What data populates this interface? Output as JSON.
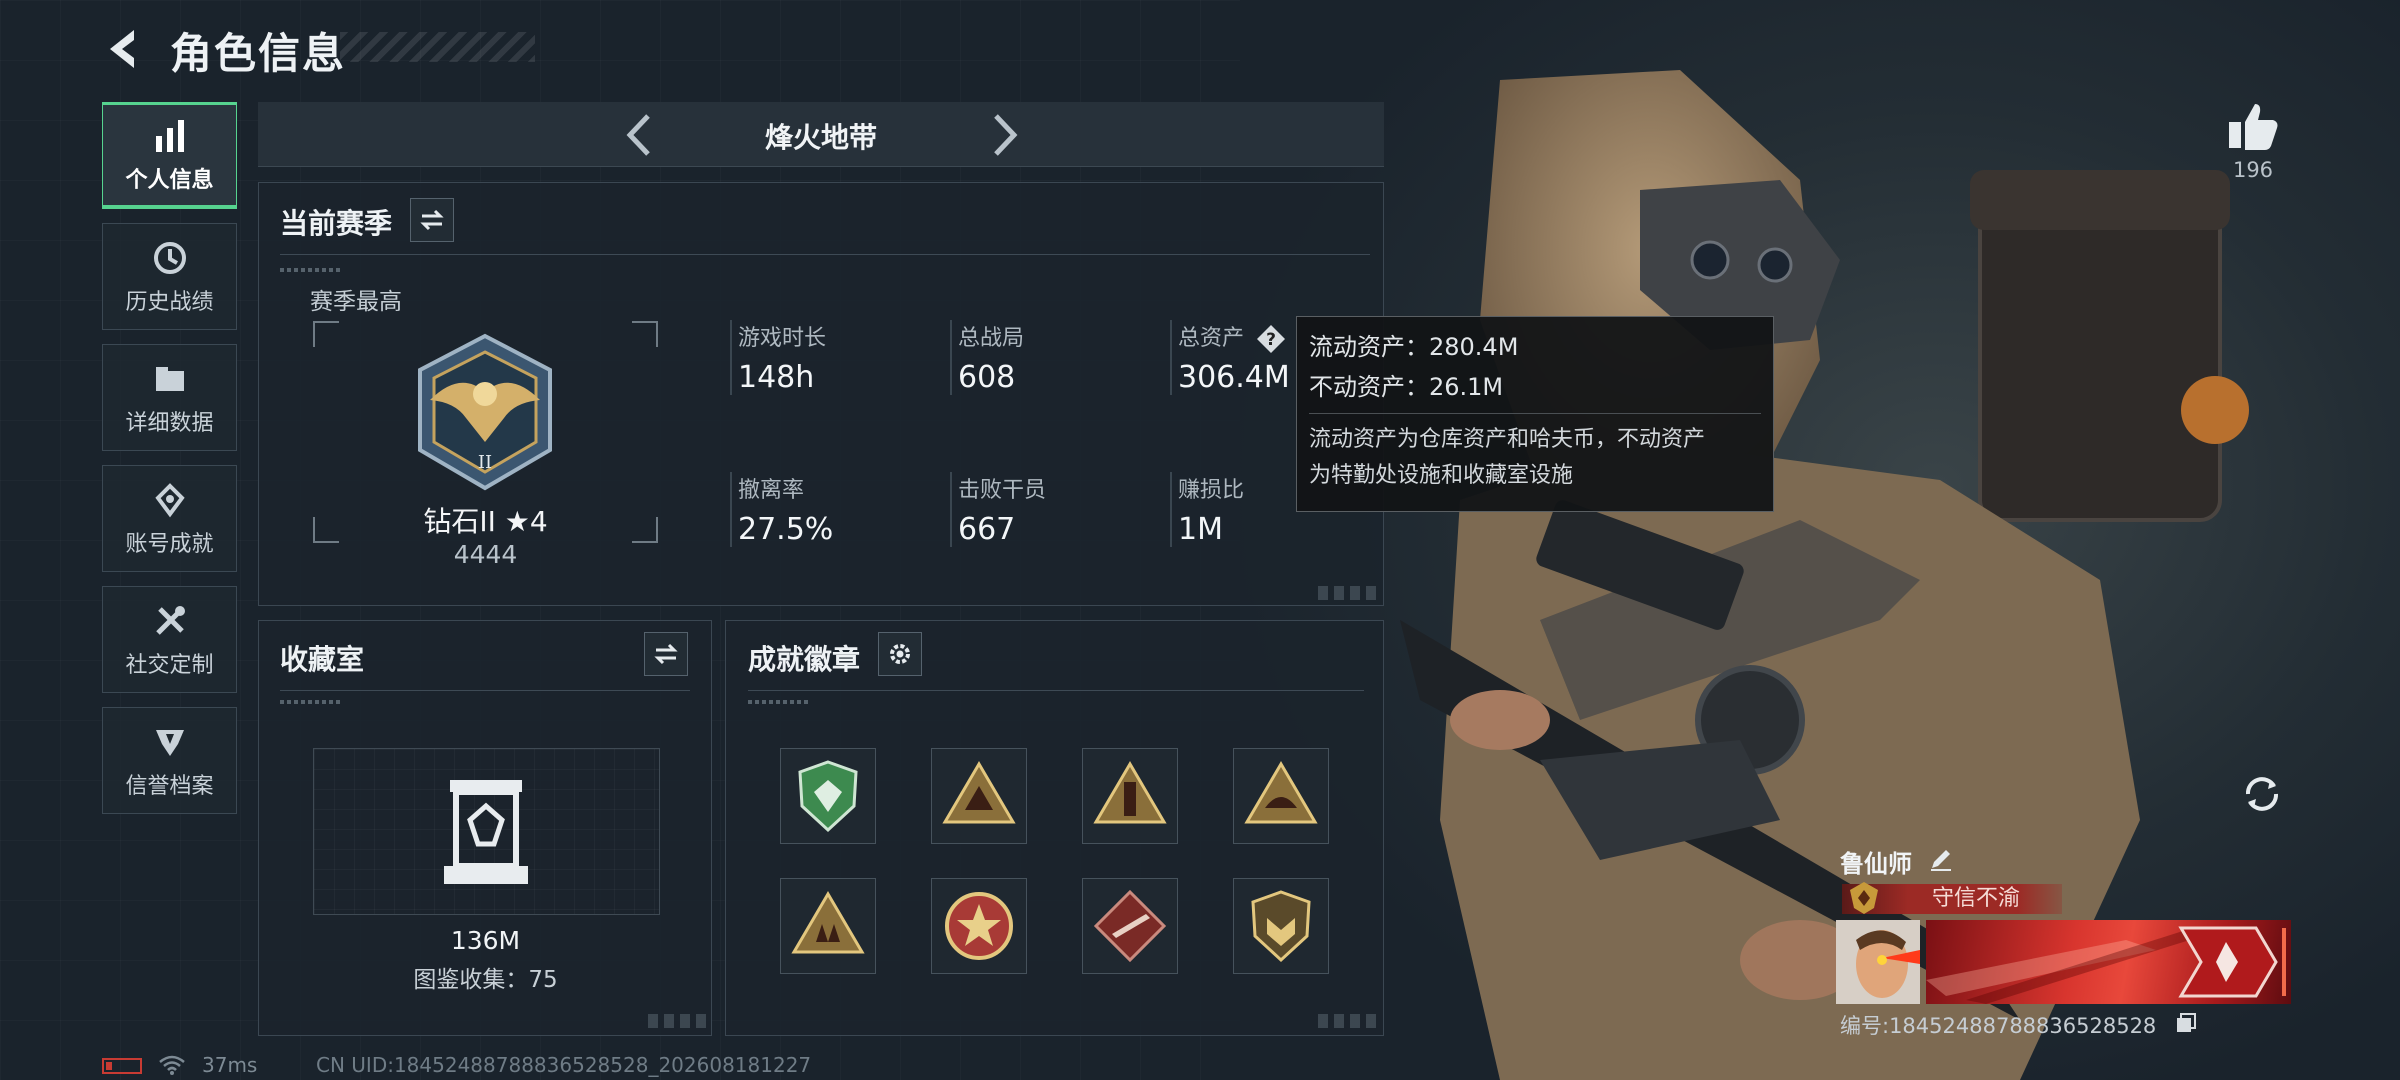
{
  "header": {
    "title": "角色信息"
  },
  "sidebar": {
    "items": [
      {
        "label": "个人信息",
        "icon": "bar-chart-icon",
        "active": true
      },
      {
        "label": "历史战绩",
        "icon": "history-clock-icon"
      },
      {
        "label": "详细数据",
        "icon": "folder-icon"
      },
      {
        "label": "账号成就",
        "icon": "achievement-icon"
      },
      {
        "label": "社交定制",
        "icon": "tools-icon"
      },
      {
        "label": "信誉档案",
        "icon": "credit-shield-icon"
      }
    ]
  },
  "mode": {
    "title": "烽火地带"
  },
  "season": {
    "title": "当前赛季",
    "best_label": "赛季最高",
    "rank": "钻石II ★4",
    "score": "4444",
    "stats": [
      {
        "label": "游戏时长",
        "value": "148h"
      },
      {
        "label": "总战局",
        "value": "608"
      },
      {
        "label": "总资产",
        "value": "306.4M",
        "has_help": true
      },
      {
        "label": "撤离率",
        "value": "27.5%"
      },
      {
        "label": "击败干员",
        "value": "667"
      },
      {
        "label": "赚损比",
        "value": "1M"
      }
    ]
  },
  "tooltip": {
    "liquid": "流动资产：280.4M",
    "fixed": "不动资产：26.1M",
    "desc_line1": "流动资产为仓库资产和哈夫币，不动资产",
    "desc_line2": "为特勤处设施和收藏室设施"
  },
  "collection": {
    "title": "收藏室",
    "value": "136M",
    "catalog": "图鉴收集：75"
  },
  "achievements": {
    "title": "成就徽章",
    "medals": [
      {
        "icon": "green-shield-medal-icon",
        "color": "#3d8a4f"
      },
      {
        "icon": "triangle-medal-icon",
        "color": "#b8934a"
      },
      {
        "icon": "tower-medal-icon",
        "color": "#b8934a"
      },
      {
        "icon": "sunrise-medal-icon",
        "color": "#b8934a"
      },
      {
        "icon": "triangle-squad-medal-icon",
        "color": "#b8934a"
      },
      {
        "icon": "star-wreath-medal-icon",
        "color": "#a83a36"
      },
      {
        "icon": "diamond-rifle-medal-icon",
        "color": "#7a2a26"
      },
      {
        "icon": "shield-crest-medal-icon",
        "color": "#b8934a"
      }
    ]
  },
  "profile": {
    "likes": "196",
    "name": "鲁仙师",
    "title_badge": "守信不渝",
    "uid_line": "编号:184524887888365285​28",
    "accent": "#56d38f"
  },
  "status": {
    "ping": "37ms",
    "uid_footer": "CN UID:1845248878883652852​8_202608181227"
  }
}
